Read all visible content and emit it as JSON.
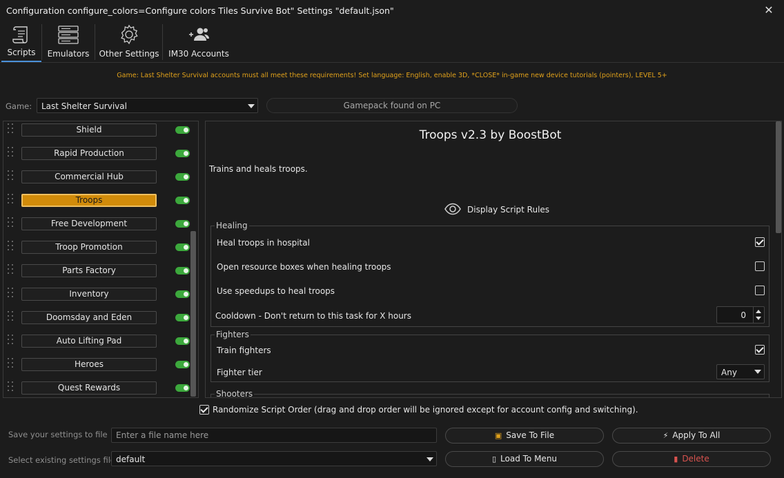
{
  "window": {
    "title": "Configuration configure_colors=Configure colors Tiles Survive Bot\" Settings \"default.json\"",
    "close_glyph": "✕"
  },
  "tabs": [
    {
      "label": "Scripts",
      "icon": "scroll-icon",
      "active": true
    },
    {
      "label": "Emulators",
      "icon": "server-icon",
      "active": false
    },
    {
      "label": "Other Settings",
      "icon": "gear-icon",
      "active": false
    },
    {
      "label": "IM30 Accounts",
      "icon": "users-icon",
      "active": false
    }
  ],
  "notice": "Game: Last Shelter Survival accounts must all meet these requirements! Set language: English, enable 3D, *CLOSE* in-game new device tutorials (pointers), LEVEL 5+",
  "game": {
    "label": "Game:",
    "selected": "Last Shelter Survival",
    "gamepack_status": "Gamepack found on PC"
  },
  "scripts": [
    {
      "label": "Shield",
      "enabled": true,
      "selected": false
    },
    {
      "label": "Rapid Production",
      "enabled": true,
      "selected": false
    },
    {
      "label": "Commercial Hub",
      "enabled": true,
      "selected": false
    },
    {
      "label": "Troops",
      "enabled": true,
      "selected": true
    },
    {
      "label": "Free Development",
      "enabled": true,
      "selected": false
    },
    {
      "label": "Troop Promotion",
      "enabled": true,
      "selected": false
    },
    {
      "label": "Parts Factory",
      "enabled": true,
      "selected": false
    },
    {
      "label": "Inventory",
      "enabled": true,
      "selected": false
    },
    {
      "label": "Doomsday and Eden",
      "enabled": true,
      "selected": false
    },
    {
      "label": "Auto Lifting Pad",
      "enabled": true,
      "selected": false
    },
    {
      "label": "Heroes",
      "enabled": true,
      "selected": false
    },
    {
      "label": "Quest Rewards",
      "enabled": true,
      "selected": false
    }
  ],
  "detail": {
    "title": "Troops v2.3 by BoostBot",
    "description": "Trains and heals troops.",
    "rules_label": "Display Script Rules",
    "healing": {
      "title": "Healing",
      "heal_in_hospital": {
        "label": "Heal troops in hospital",
        "checked": true
      },
      "open_resource_boxes": {
        "label": "Open resource boxes when healing troops",
        "checked": false
      },
      "use_speedups": {
        "label": "Use speedups to heal troops",
        "checked": false
      },
      "cooldown": {
        "label": "Cooldown - Don't return to this task for X hours",
        "value": "0"
      }
    },
    "fighters": {
      "title": "Fighters",
      "train_fighters": {
        "label": "Train fighters",
        "checked": true
      },
      "fighter_tier": {
        "label": "Fighter tier",
        "value": "Any"
      }
    },
    "shooters": {
      "title": "Shooters"
    }
  },
  "randomize": {
    "label": "Randomize Script Order (drag and drop order will be ignored except for account config and switching).",
    "checked": true
  },
  "save": {
    "label": "Save your settings to file",
    "placeholder": "Enter a file name here",
    "save_button": "Save To File",
    "apply_button": "Apply To All"
  },
  "load": {
    "label": "Select existing settings file",
    "selected": "default",
    "load_button": "Load To Menu",
    "delete_button": "Delete"
  },
  "colors": {
    "accent": "#d18b0a",
    "notice": "#e0a11b",
    "toggle_on": "#3ca83c",
    "delete": "#d9534f",
    "tab_active": "#4a90d9"
  }
}
